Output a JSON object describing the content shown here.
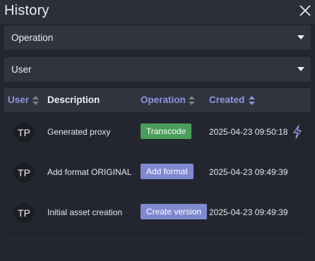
{
  "panel": {
    "title": "History"
  },
  "filters": [
    {
      "label": "Operation"
    },
    {
      "label": "User"
    }
  ],
  "table": {
    "columns": [
      "User",
      "Description",
      "Operation",
      "Created"
    ],
    "rows": [
      {
        "user": "TP",
        "description": "Generated proxy",
        "operation": "Transcode",
        "operation_color": "#4a9d5b",
        "created": "2025-04-23 09:50:18",
        "has_action_icon": true
      },
      {
        "user": "TP",
        "description": "Add format ORIGINAL",
        "operation": "Add format",
        "operation_color": "#7f89d1",
        "created": "2025-04-23 09:49:39",
        "has_action_icon": false
      },
      {
        "user": "TP",
        "description": "Initial asset creation",
        "operation": "Create version",
        "operation_color": "#7f89d1",
        "created": "2025-04-23 09:49:39",
        "has_action_icon": false
      }
    ]
  },
  "colors": {
    "accent": "#8b96e0",
    "background": "#23262e",
    "transcode_badge": "#4a9d5b",
    "version_badge": "#7f89d1"
  },
  "icons": {
    "close": "close-icon",
    "dropdown": "chevron-down-icon",
    "sort": "sort-icon",
    "action": "lightning-icon"
  }
}
